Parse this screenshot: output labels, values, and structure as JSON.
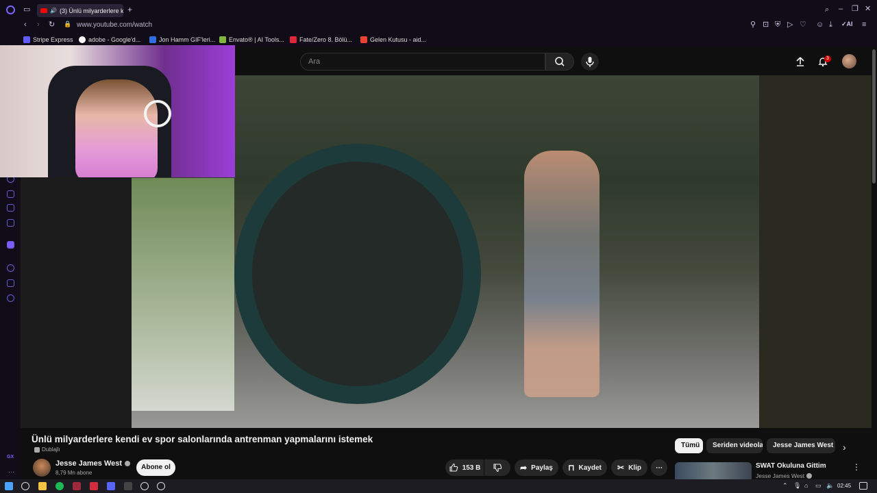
{
  "browser": {
    "tab_title": "(3) Ünlü milyarderlere k",
    "url": "www.youtube.com/watch",
    "bookmarks": [
      {
        "label": "Stripe Express",
        "icon": "stripe-icon",
        "color": "#635bff"
      },
      {
        "label": "adobe - Google'd...",
        "icon": "google-icon",
        "color": "#ffffff"
      },
      {
        "label": "Jon Hamm GIF'leri...",
        "icon": "gif-icon",
        "color": "#2f6de1"
      },
      {
        "label": "Envato® | AI Tools...",
        "icon": "envato-icon",
        "color": "#82b440"
      },
      {
        "label": "Fate/Zero 8. Bölü...",
        "icon": "anime-icon",
        "color": "#e0263a"
      },
      {
        "label": "Gelen Kutusu - aid...",
        "icon": "gmail-icon",
        "color": "#ea4335"
      }
    ]
  },
  "youtube": {
    "search_placeholder": "Ara",
    "notification_count": "3",
    "video_title": "Ünlü milyarderlere kendi ev spor salonlarında antrenman yapmalarını istemek",
    "dub_label": "Dublajlı",
    "channel_name": "Jesse James West",
    "subscribers": "8,79 Mn abone",
    "subscribe_label": "Abone ol",
    "likes": "153 B",
    "share_label": "Paylaş",
    "save_label": "Kaydet",
    "clip_label": "Klip",
    "chips": [
      "Tümü",
      "Seriden videolar",
      "Jesse James West ad"
    ],
    "recommendation": {
      "title": "SWAT Okuluna Gittim",
      "channel": "Jesse James West"
    }
  },
  "system": {
    "clock": "02:45",
    "sidebar_label": "GX"
  },
  "colors": {
    "accent": "#8a6cff",
    "youtube_red": "#ff0000",
    "notification_badge": "#cc0000"
  }
}
